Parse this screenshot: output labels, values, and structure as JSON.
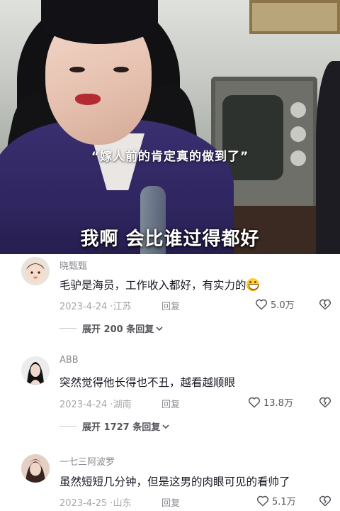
{
  "video": {
    "caption_quote": "“嫁人前的肯定真的做到了”",
    "subtitle": "我啊 会比谁过得都好"
  },
  "comments": [
    {
      "username": "晓甄甄",
      "text": "毛驴是海员，工作收入都好，有实力的",
      "emoji": "grinning-face-emoji",
      "date": "2023-4-24",
      "location": "江苏",
      "reply_label": "回复",
      "likes": "5.0万",
      "expand_label": "展开 200 条回复"
    },
    {
      "username": "ABB",
      "text": "突然觉得他长得也不丑，越看越顺眼",
      "date": "2023-4-24",
      "location": "湖南",
      "reply_label": "回复",
      "likes": "13.8万",
      "expand_label": "展开 1727 条回复"
    },
    {
      "username": "一七三阿波罗",
      "text": "虽然短短几分钟，但是这男的肉眼可见的看帅了",
      "date": "2023-4-25",
      "location": "山东",
      "reply_label": "回复",
      "likes": "5.1万"
    }
  ],
  "colors": {
    "text_primary": "#161823",
    "text_secondary": "#8a8b91",
    "text_meta": "#a6a7ab",
    "coat_purple": "#2f2660"
  }
}
